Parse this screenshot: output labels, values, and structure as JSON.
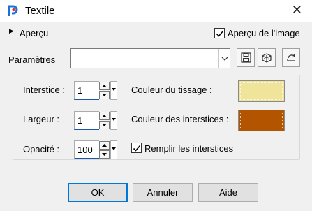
{
  "window": {
    "title": "Textile"
  },
  "preview": {
    "label": "Aperçu",
    "image_label": "Aperçu de l'image",
    "image_checked": true
  },
  "presets": {
    "label": "Paramètres",
    "value": ""
  },
  "fields": {
    "interstice": {
      "label": "Interstice :",
      "value": "1"
    },
    "largeur": {
      "label": "Largeur :",
      "value": "1"
    },
    "opacite": {
      "label": "Opacité :",
      "value": "100"
    }
  },
  "colors": {
    "weave": {
      "label": "Couleur du tissage :",
      "value": "#f0e49a"
    },
    "gap": {
      "label": "Couleur des interstices :",
      "value": "#b35400"
    }
  },
  "fill_gaps": {
    "label": "Remplir les interstices",
    "checked": true
  },
  "buttons": {
    "ok": "OK",
    "cancel": "Annuler",
    "help": "Aide"
  }
}
